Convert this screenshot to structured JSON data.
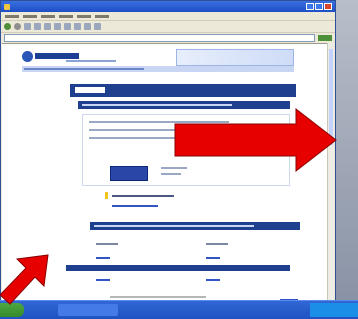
{
  "window": {
    "title": ""
  },
  "page": {
    "banner_title": "",
    "enter_button_label": ""
  },
  "annotations": {
    "arrow_color": "#e60000"
  },
  "colors": {
    "titlebar": "#1c4fc7",
    "site_navy": "#1f3f8f",
    "link_blue": "#3155c4",
    "taskbar": "#1f51c2"
  }
}
